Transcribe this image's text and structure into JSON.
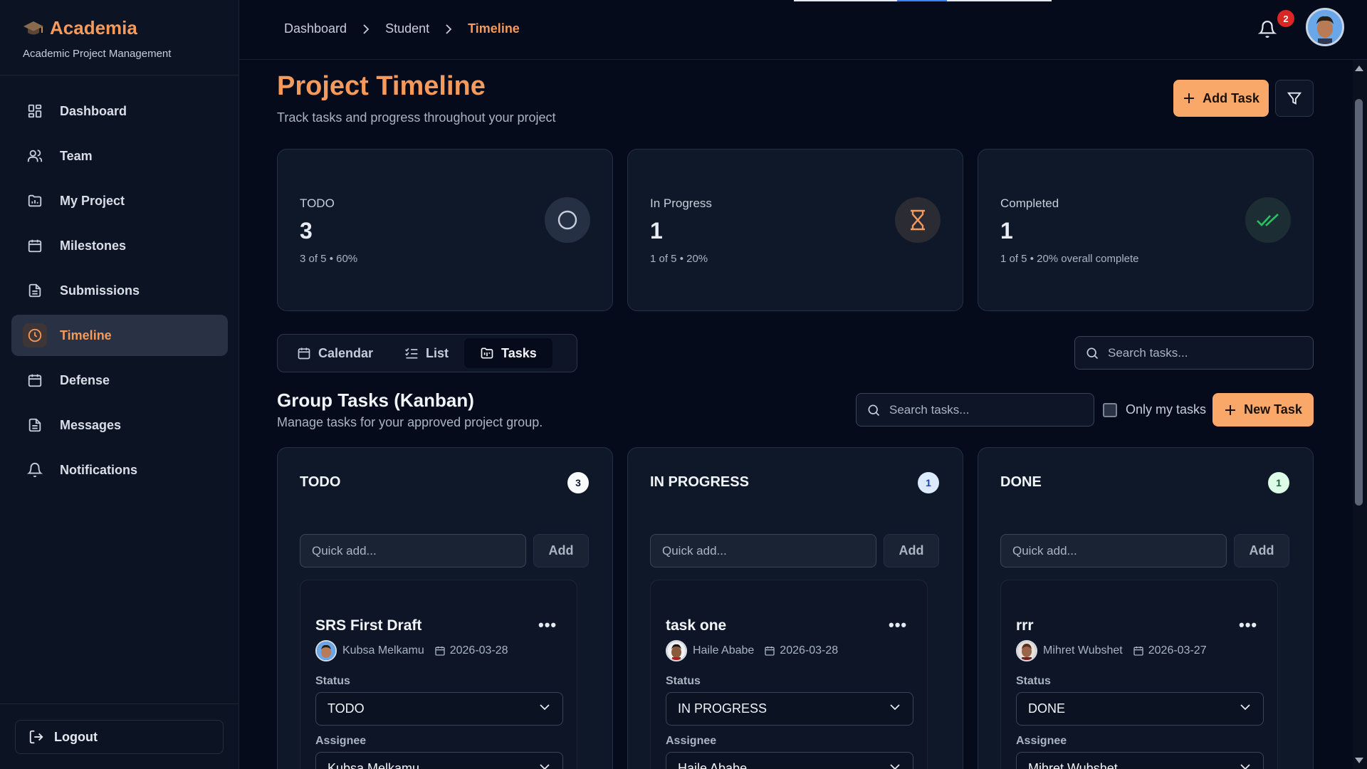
{
  "brand": {
    "title": "Academia",
    "subtitle": "Academic Project Management"
  },
  "sidebar": {
    "items": [
      {
        "label": "Dashboard",
        "icon": "dashboard-icon"
      },
      {
        "label": "Team",
        "icon": "users-icon"
      },
      {
        "label": "My Project",
        "icon": "folder-chart-icon"
      },
      {
        "label": "Milestones",
        "icon": "calendar-icon"
      },
      {
        "label": "Submissions",
        "icon": "file-icon"
      },
      {
        "label": "Timeline",
        "icon": "clock-icon",
        "active": true
      },
      {
        "label": "Defense",
        "icon": "calendar-icon"
      },
      {
        "label": "Messages",
        "icon": "file-icon"
      },
      {
        "label": "Notifications",
        "icon": "bell-icon"
      }
    ],
    "logout_label": "Logout"
  },
  "breadcrumb": {
    "items": [
      "Dashboard",
      "Student",
      "Timeline"
    ],
    "separator": ">"
  },
  "notifications": {
    "count": "2"
  },
  "header": {
    "title": "Project Timeline",
    "subtitle": "Track tasks and progress throughout your project",
    "add_task_label": "Add Task"
  },
  "stats": [
    {
      "label": "TODO",
      "value": "3",
      "meta": "3 of 5 • 60%",
      "icon": "circle-icon"
    },
    {
      "label": "In Progress",
      "value": "1",
      "meta": "1 of 5 • 20%",
      "icon": "hourglass-icon"
    },
    {
      "label": "Completed",
      "value": "1",
      "meta": "1 of 5 • 20% overall complete",
      "icon": "double-check-icon"
    }
  ],
  "view_tabs": [
    {
      "label": "Calendar",
      "icon": "calendar-icon"
    },
    {
      "label": "List",
      "icon": "list-check-icon"
    },
    {
      "label": "Tasks",
      "icon": "kanban-folder-icon",
      "active": true
    }
  ],
  "top_search": {
    "placeholder": "Search tasks..."
  },
  "kanban": {
    "title": "Group Tasks (Kanban)",
    "subtitle": "Manage tasks for your approved project group.",
    "search_placeholder": "Search tasks...",
    "only_mine_label": "Only my tasks",
    "new_task_label": "New Task",
    "quick_add_placeholder": "Quick add...",
    "add_label": "Add",
    "status_label": "Status",
    "assignee_label": "Assignee",
    "columns": [
      {
        "title": "TODO",
        "count": "3",
        "badge_bg": "#f8fafc",
        "badge_fg": "#0f172a",
        "task": {
          "name": "SRS First Draft",
          "assignee": "Kubsa Melkamu",
          "date": "2026-03-28",
          "status": "TODO",
          "assignee_value": "Kubsa Melkamu"
        }
      },
      {
        "title": "IN PROGRESS",
        "count": "1",
        "badge_bg": "#dbeafe",
        "badge_fg": "#1e40af",
        "task": {
          "name": "task one",
          "assignee": "Haile Ababe",
          "date": "2026-03-28",
          "status": "IN PROGRESS",
          "assignee_value": "Haile Ababe"
        }
      },
      {
        "title": "DONE",
        "count": "1",
        "badge_bg": "#dcfce7",
        "badge_fg": "#166534",
        "task": {
          "name": "rrr",
          "assignee": "Mihret Wubshet",
          "date": "2026-03-27",
          "status": "DONE",
          "assignee_value": "Mihret Wubshet"
        }
      }
    ]
  },
  "colors": {
    "accent": "#f39a5c",
    "background": "#050b1a",
    "card": "#0f1829",
    "button_orange": "#f9a86a",
    "badge_red": "#dc2626"
  }
}
